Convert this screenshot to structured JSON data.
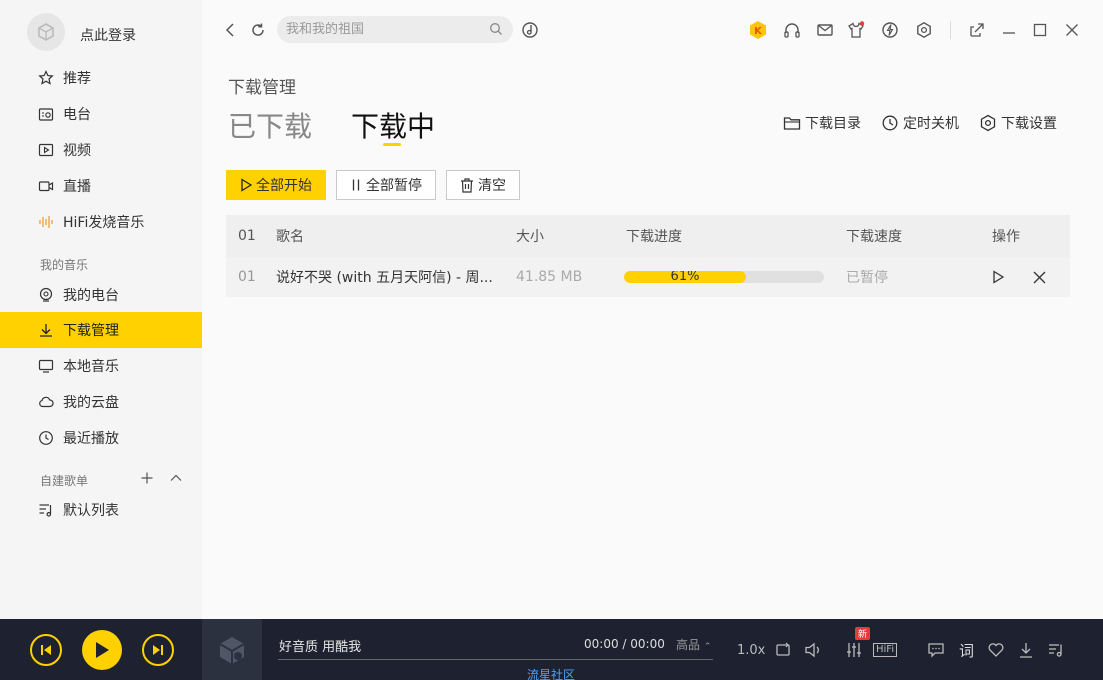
{
  "sidebar": {
    "login_label": "点此登录",
    "nav": [
      {
        "label": "推荐",
        "icon": "star-icon"
      },
      {
        "label": "电台",
        "icon": "radio-icon"
      },
      {
        "label": "视频",
        "icon": "video-icon"
      },
      {
        "label": "直播",
        "icon": "camera-icon"
      },
      {
        "label": "HiFi发烧音乐",
        "icon": "waveform-icon"
      }
    ],
    "my_music_title": "我的音乐",
    "my_music": [
      {
        "label": "我的电台",
        "icon": "location-icon"
      },
      {
        "label": "下载管理",
        "icon": "download-icon"
      },
      {
        "label": "本地音乐",
        "icon": "monitor-icon"
      },
      {
        "label": "我的云盘",
        "icon": "cloud-icon"
      },
      {
        "label": "最近播放",
        "icon": "clock-icon"
      }
    ],
    "playlists_title": "自建歌单",
    "playlists": [
      {
        "label": "默认列表",
        "icon": "playlist-icon"
      }
    ]
  },
  "search": {
    "placeholder": "我和我的祖国"
  },
  "page": {
    "title": "下载管理",
    "tabs": [
      "已下载",
      "下载中"
    ],
    "active_tab": 1,
    "actions": [
      "下载目录",
      "定时关机",
      "下载设置"
    ]
  },
  "toolbar": {
    "start_all": "全部开始",
    "pause_all": "全部暂停",
    "clear": "清空"
  },
  "table": {
    "headers": [
      "01",
      "歌名",
      "大小",
      "下载进度",
      "下载速度",
      "操作"
    ],
    "rows": [
      {
        "index": "01",
        "name": "说好不哭 (with 五月天阿信) - 周...",
        "size": "41.85 MB",
        "progress": 0.61,
        "progress_text": "61%",
        "speed": "已暂停"
      }
    ]
  },
  "player": {
    "song_title": "好音质 用酷我",
    "time": "00:00 / 00:00",
    "quality": "高品",
    "speed": "1.0x",
    "hifi": "HiFi",
    "new_badge": "新",
    "lyric_label": "词",
    "community_link": "流星社区"
  },
  "colors": {
    "accent": "#ffd100",
    "player_bg": "#1e2230",
    "sidebar_bg": "#f5f5f5"
  }
}
